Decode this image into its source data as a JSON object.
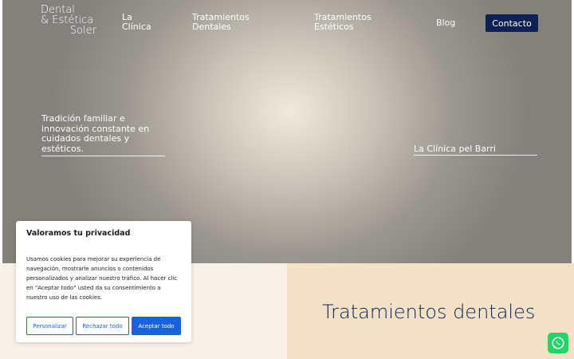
{
  "header": {
    "logo": {
      "line1": "Dental",
      "line2": "& Estética",
      "line3": "Soler"
    },
    "nav": [
      {
        "line1": "La",
        "line2": "Clínica"
      },
      {
        "line1": "Tratamientos",
        "line2": "Dentales"
      },
      {
        "line1": "Tratamientos",
        "line2": "Estéticos"
      },
      {
        "line1": "Blog"
      }
    ],
    "contact_label": "Contacto"
  },
  "hero": {
    "tagline": "Tradición familiar e innovación constante en cuidados dentales y estéticos.",
    "link": "La Clínica pel Barri"
  },
  "section": {
    "title": "Tratamientos dentales"
  },
  "cookie_banner": {
    "title": "Valoramos tu privacidad",
    "text": "Usamos cookies para mejorar su experiencia de navegación, mostrarle anuncios o contenidos personalizados y analizar nuestro tráfico. Al hacer clic en \"Aceptar todo\" usted da su consentimiento a nuestro uso de las cookies.",
    "buttons": {
      "customize": "Personalizar",
      "reject": "Rechazar todo",
      "accept": "Aceptar todo"
    }
  },
  "colors": {
    "brand_navy": "#0d2154",
    "cookie_blue": "#1863dc",
    "whatsapp_green": "#25d366"
  },
  "icons": {
    "whatsapp": "whatsapp-icon"
  }
}
